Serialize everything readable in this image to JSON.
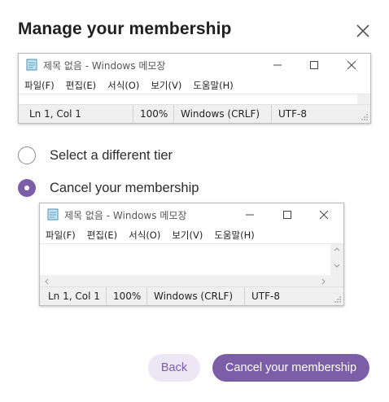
{
  "dialog": {
    "title": "Manage your membership",
    "options": [
      {
        "label": "Select a different tier",
        "selected": false
      },
      {
        "label": "Cancel your membership",
        "selected": true
      }
    ],
    "back_label": "Back",
    "confirm_label": "Cancel your membership",
    "accent_color": "#7b5ea7"
  },
  "notepad": {
    "title": "제목 없음 - Windows 메모장",
    "menu": [
      "파일(F)",
      "편집(E)",
      "서식(O)",
      "보기(V)",
      "도움말(H)"
    ],
    "status": {
      "position": "Ln 1, Col 1",
      "zoom": "100%",
      "line_ending": "Windows (CRLF)",
      "encoding": "UTF-8"
    }
  }
}
